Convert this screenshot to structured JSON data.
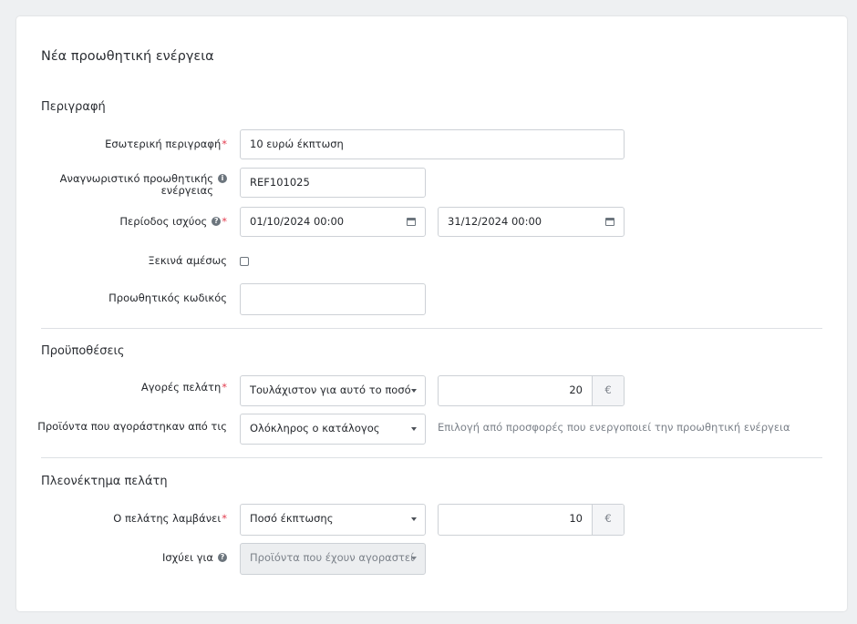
{
  "form": {
    "title": "Νέα προωθητική ενέργεια",
    "description": {
      "section_title": "Περιγραφή",
      "internal_label": "Εσωτερική περιγραφή",
      "internal_value": "10 ευρώ έκπτωση",
      "reference_label_line1": "Αναγνωριστικό προωθητικής",
      "reference_label_line2": "ενέργειας",
      "reference_value": "REF101025",
      "validity_label": "Περίοδος ισχύος",
      "validity_start": "01/10/2024 00:00",
      "validity_end": "31/12/2024 00:00",
      "starts_immediately_label": "Ξεκινά αμέσως",
      "starts_immediately_checked": false,
      "promo_code_label": "Προωθητικός κωδικός",
      "promo_code_value": ""
    },
    "conditions": {
      "section_title": "Προϋποθέσεις",
      "purchases_label": "Αγορές πελάτη",
      "purchases_select": "Τουλάχιστον για αυτό το ποσό",
      "purchases_amount": "20",
      "purchases_unit": "€",
      "products_label": "Προϊόντα που αγοράστηκαν από τις",
      "products_select": "Ολόκληρος ο κατάλογος",
      "products_hint": "Επιλογή από προσφορές που ενεργοποιεί την προωθητική ενέργεια"
    },
    "benefit": {
      "section_title": "Πλεονέκτημα πελάτη",
      "receives_label": "Ο πελάτης λαμβάνει",
      "receives_select": "Ποσό έκπτωσης",
      "receives_amount": "10",
      "receives_unit": "€",
      "applies_label": "Ισχύει για",
      "applies_select": "Προϊόντα που έχουν αγοραστεί"
    },
    "required_mark": "*",
    "info_glyph": "i",
    "help_glyph": "?"
  }
}
